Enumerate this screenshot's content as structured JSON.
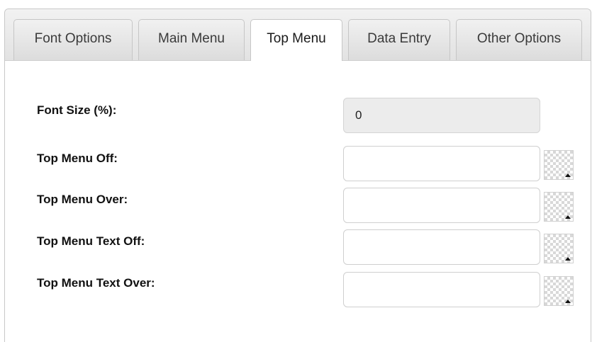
{
  "tabs": [
    {
      "label": "Font Options",
      "active": false
    },
    {
      "label": "Main Menu",
      "active": false
    },
    {
      "label": "Top Menu",
      "active": true
    },
    {
      "label": "Data Entry",
      "active": false
    },
    {
      "label": "Other Options",
      "active": false
    }
  ],
  "form": {
    "font_size": {
      "label": "Font Size (%):",
      "value": "0"
    },
    "top_menu_off": {
      "label": "Top Menu Off:",
      "value": "",
      "swatch_icon": "color-picker-icon"
    },
    "top_menu_over": {
      "label": "Top Menu Over:",
      "value": "",
      "swatch_icon": "color-picker-icon"
    },
    "top_menu_text_off": {
      "label": "Top Menu Text Off:",
      "value": "",
      "swatch_icon": "color-picker-icon"
    },
    "top_menu_text_over": {
      "label": "Top Menu Text Over:",
      "value": "",
      "swatch_icon": "color-picker-icon"
    }
  }
}
